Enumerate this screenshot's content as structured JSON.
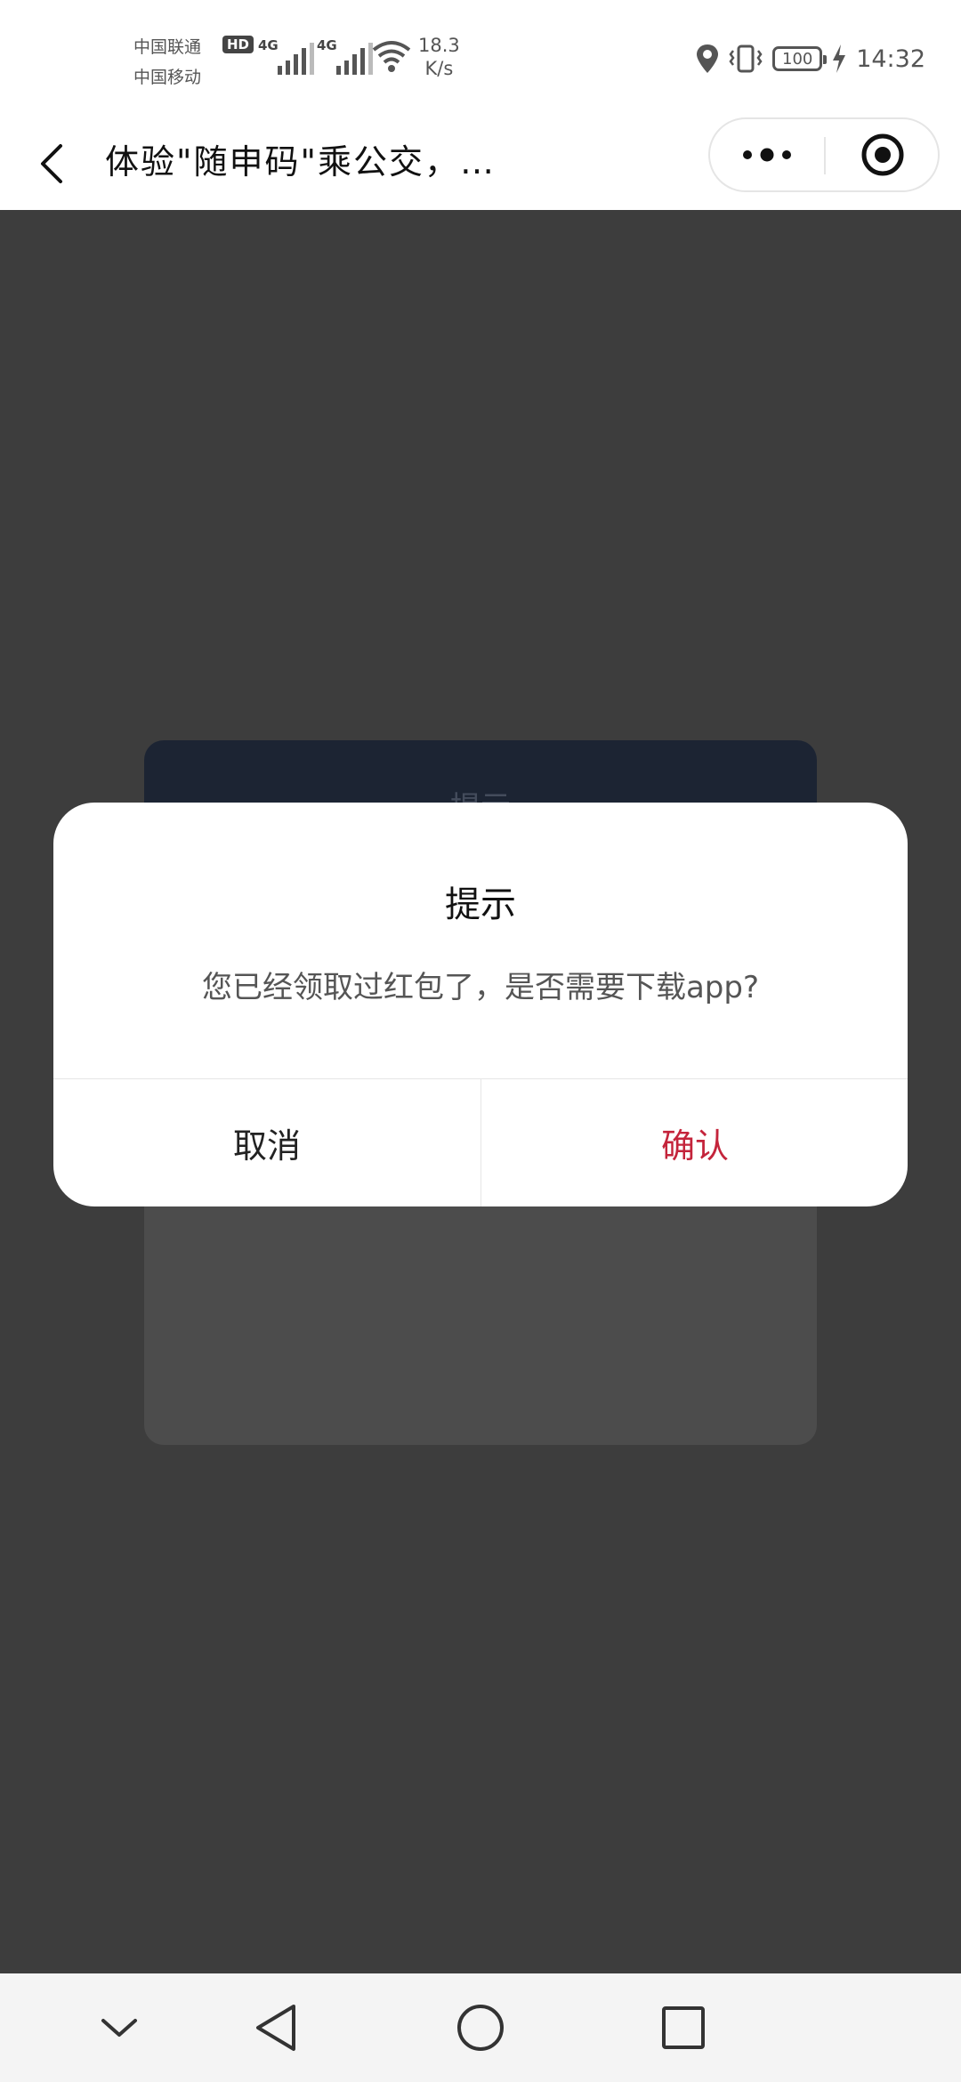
{
  "status_bar": {
    "carrier_1": "中国联通",
    "carrier_2": "中国移动",
    "hd_badge": "HD",
    "network_1": "4G",
    "network_2": "4G",
    "speed_value": "18.3",
    "speed_unit": "K/s",
    "battery": "100",
    "time": "14:32"
  },
  "navbar": {
    "title": "体验\"随申码\"乘公交，…",
    "icons": [
      "back-icon",
      "more-icon",
      "close-target-icon"
    ]
  },
  "background_card": {
    "title": "提示"
  },
  "dialog": {
    "title": "提示",
    "message": "您已经领取过红包了，是否需要下载app?",
    "cancel_label": "取消",
    "confirm_label": "确认",
    "confirm_color": "#c4243b"
  },
  "system_nav": {
    "icons": [
      "collapse-icon",
      "back-triangle-icon",
      "home-circle-icon",
      "recents-square-icon"
    ]
  }
}
